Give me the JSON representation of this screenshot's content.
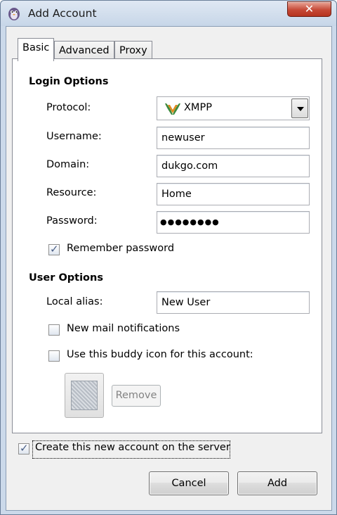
{
  "window": {
    "title": "Add Account",
    "close_label": "✕"
  },
  "tabs": [
    {
      "label": "Basic",
      "active": true
    },
    {
      "label": "Advanced",
      "active": false
    },
    {
      "label": "Proxy",
      "active": false
    }
  ],
  "login_options": {
    "heading": "Login Options",
    "protocol_label": "Protocol:",
    "protocol_value": "XMPP",
    "username_label": "Username:",
    "username_value": "newuser",
    "domain_label": "Domain:",
    "domain_value": "dukgo.com",
    "resource_label": "Resource:",
    "resource_value": "Home",
    "password_label": "Password:",
    "password_value": "●●●●●●●●",
    "remember_password_label": "Remember password",
    "remember_password_checked": true
  },
  "user_options": {
    "heading": "User Options",
    "local_alias_label": "Local alias:",
    "local_alias_value": "New User",
    "new_mail_label": "New mail notifications",
    "new_mail_checked": false,
    "buddy_icon_label": "Use this buddy icon for this account:",
    "buddy_icon_checked": false,
    "remove_label": "Remove"
  },
  "footer": {
    "create_on_server_label": "Create this new account on the server",
    "create_on_server_checked": true,
    "cancel_label": "Cancel",
    "add_label": "Add"
  },
  "icons": {
    "app": "pidgin-icon",
    "protocol": "xmpp-icon",
    "close": "close-icon",
    "dropdown": "chevron-down-icon",
    "buddy": "buddy-icon-placeholder"
  },
  "colors": {
    "title_bar": "#cbd9ea",
    "close_button": "#c64a37",
    "dialog_bg": "#f0f0f0"
  }
}
